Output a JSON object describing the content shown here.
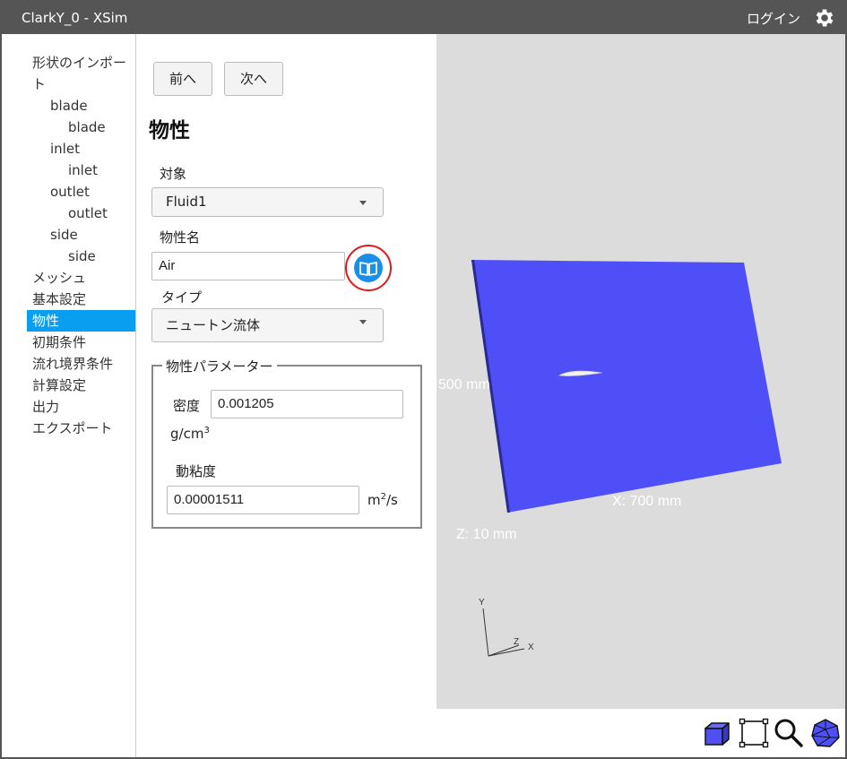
{
  "window": {
    "title": "ClarkY_0 - XSim",
    "login_label": "ログイン"
  },
  "sidebar": {
    "items": [
      {
        "label": "形状のインポー",
        "level": 0
      },
      {
        "label": "ト",
        "level": 0
      },
      {
        "label": "blade",
        "level": 1
      },
      {
        "label": "blade",
        "level": 2
      },
      {
        "label": "inlet",
        "level": 1
      },
      {
        "label": "inlet",
        "level": 2
      },
      {
        "label": "outlet",
        "level": 1
      },
      {
        "label": "outlet",
        "level": 2
      },
      {
        "label": "side",
        "level": 1
      },
      {
        "label": "side",
        "level": 2
      },
      {
        "label": "メッシュ",
        "level": 0
      },
      {
        "label": "基本設定",
        "level": 0
      },
      {
        "label": "物性",
        "level": 0,
        "active": true
      },
      {
        "label": "初期条件",
        "level": 0
      },
      {
        "label": "流れ境界条件",
        "level": 0
      },
      {
        "label": "計算設定",
        "level": 0
      },
      {
        "label": "出力",
        "level": 0
      },
      {
        "label": "エクスポート",
        "level": 0
      }
    ]
  },
  "form": {
    "prev_label": "前へ",
    "next_label": "次へ",
    "heading": "物性",
    "target_label": "対象",
    "target_value": "Fluid1",
    "material_name_label": "物性名",
    "material_name_value": "Air",
    "type_label": "タイプ",
    "type_value": "ニュートン流体",
    "params_legend": "物性パラメーター",
    "density_label": "密度",
    "density_value": "0.001205",
    "density_unit_base": "g/cm",
    "density_unit_exp": "3",
    "viscosity_label": "動粘度",
    "viscosity_value": "0.00001511",
    "viscosity_unit_base": "m",
    "viscosity_unit_exp": "2",
    "viscosity_unit_tail": "/s"
  },
  "viewport": {
    "dim_y": "500 mm",
    "dim_x": "X: 700 mm",
    "dim_z": "Z: 10 mm",
    "axis_y": "Y",
    "axis_z": "Z",
    "axis_x": "X",
    "plane_color": "#4f4ff8",
    "background_color": "#dcdcdc"
  },
  "toolbar": {
    "tools": [
      "cube-view-icon",
      "fit-frame-icon",
      "zoom-icon",
      "sphere-icon"
    ]
  },
  "colors": {
    "accent": "#0a9ef0",
    "titlebar": "#555555",
    "highlight_ring": "#e01b1b",
    "book_button": "#1a8ee8"
  }
}
